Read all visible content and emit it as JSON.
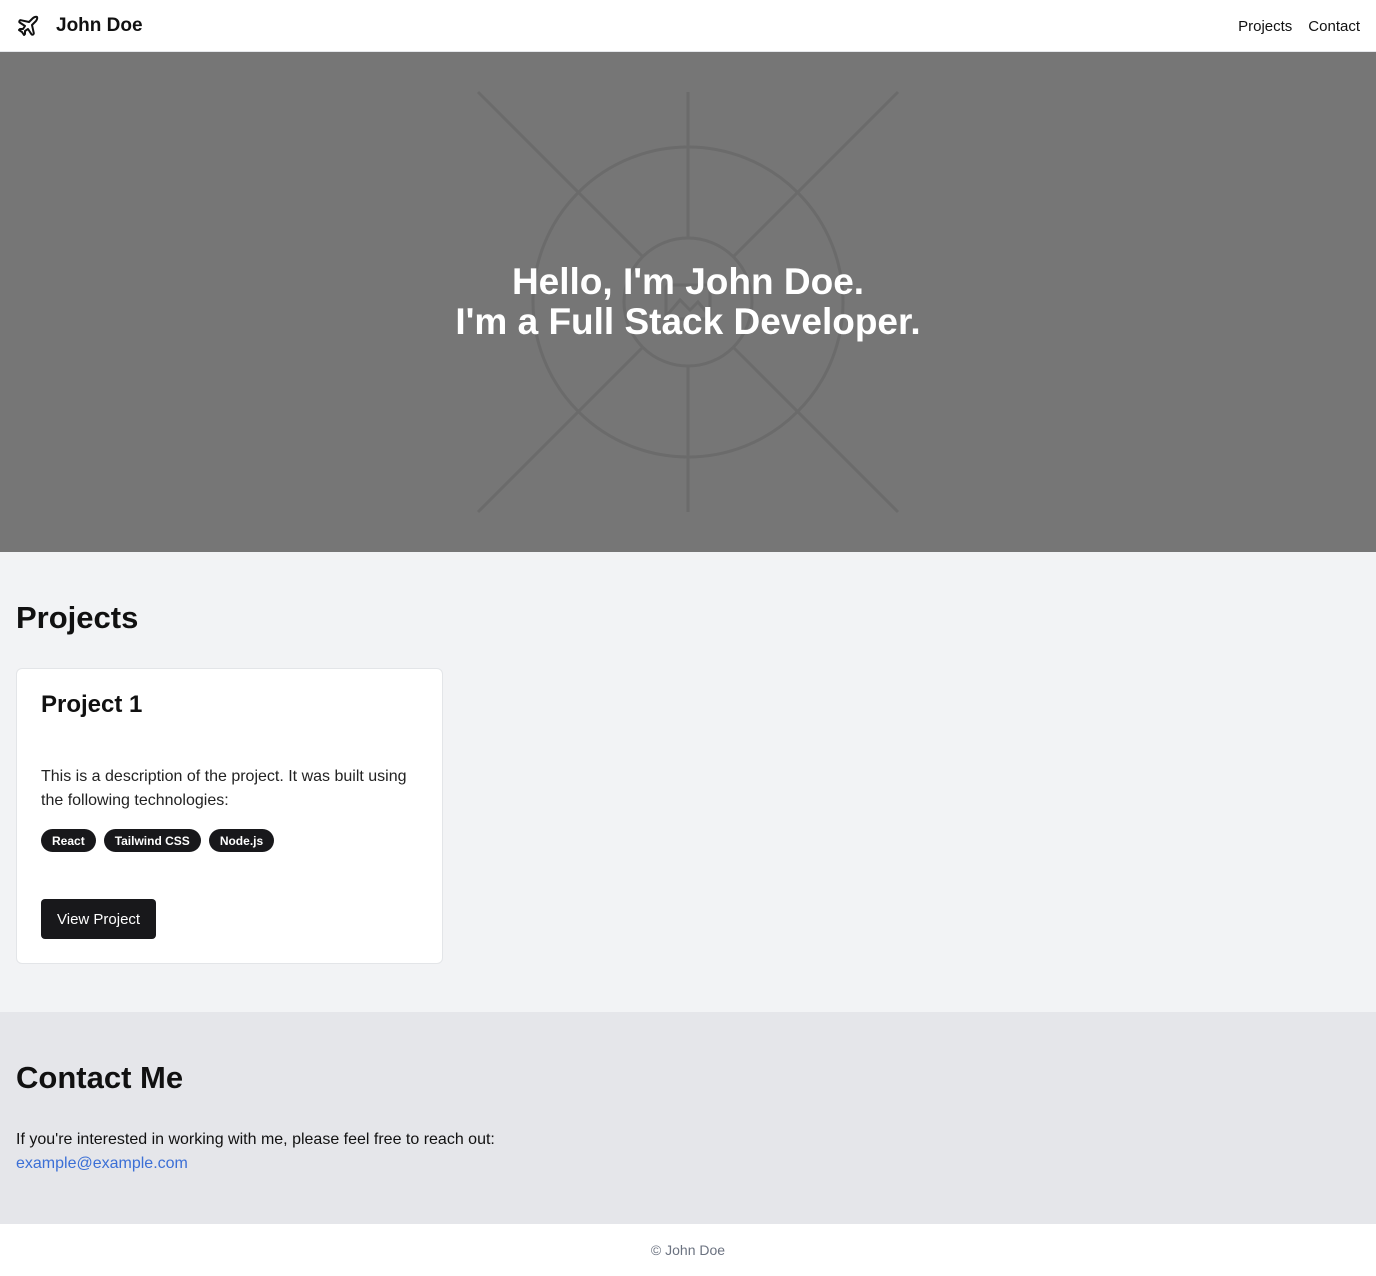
{
  "header": {
    "brand_name": "John Doe",
    "brand_icon": "plane-icon",
    "nav": [
      {
        "label": "Projects"
      },
      {
        "label": "Contact"
      }
    ]
  },
  "hero": {
    "line1": "Hello, I'm John Doe.",
    "line2": "I'm a Full Stack Developer.",
    "background_color": "#767676"
  },
  "projects": {
    "title": "Projects",
    "items": [
      {
        "title": "Project 1",
        "description": "This is a description of the project. It was built using the following technologies:",
        "tags": [
          "React",
          "Tailwind CSS",
          "Node.js"
        ],
        "button_label": "View Project"
      }
    ]
  },
  "contact": {
    "title": "Contact Me",
    "text": "If you're interested in working with me, please feel free to reach out:",
    "email": "example@example.com",
    "email_color": "#3b6fd6"
  },
  "footer": {
    "text": "© John Doe"
  }
}
